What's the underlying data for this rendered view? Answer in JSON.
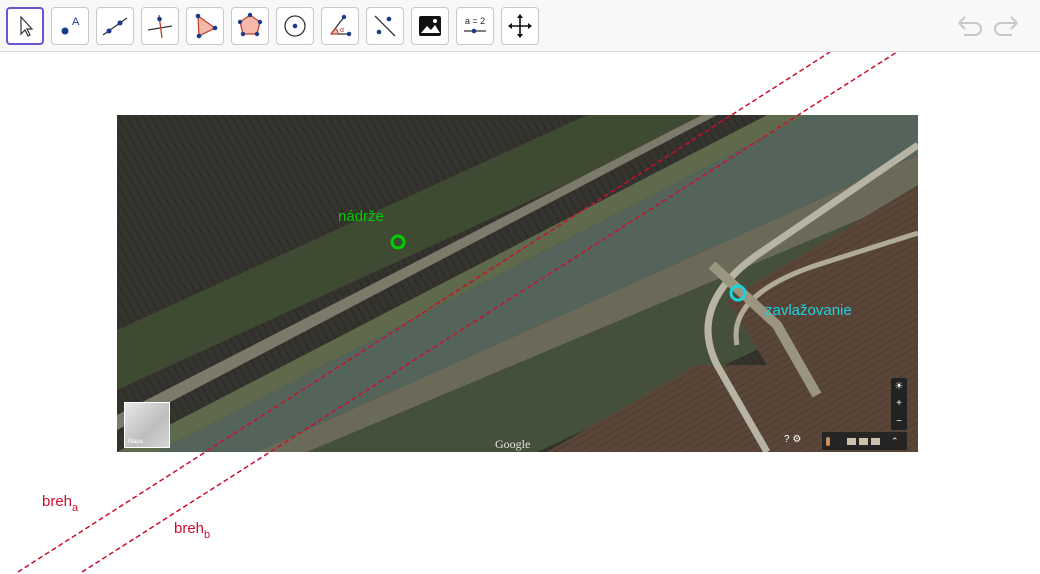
{
  "toolbar": {
    "tools": [
      {
        "icon": "move-arrow-icon",
        "selected": true
      },
      {
        "icon": "point-icon",
        "label": "A"
      },
      {
        "icon": "line-icon"
      },
      {
        "icon": "perpendicular-line-icon"
      },
      {
        "icon": "polygon-icon"
      },
      {
        "icon": "circle-with-center-icon"
      },
      {
        "icon": "angle-icon"
      },
      {
        "icon": "reflect-about-line-icon"
      },
      {
        "icon": "image-icon"
      },
      {
        "icon": "slider-icon",
        "label": "a = 2"
      },
      {
        "icon": "move-graphics-view-icon"
      }
    ],
    "undo_icon": "undo-icon",
    "redo_icon": "redo-icon"
  },
  "map": {
    "logo": "Google",
    "thumb_label": "Mapa"
  },
  "points": {
    "nadrze": {
      "label": "nádrže",
      "color": "#00cc00"
    },
    "zavlazovanie": {
      "label": "zavlažovanie",
      "color": "#19d3df"
    }
  },
  "lines": {
    "breh_a": {
      "base": "breh",
      "sub": "a",
      "color": "#c8102e"
    },
    "breh_b": {
      "base": "breh",
      "sub": "b",
      "color": "#c8102e"
    }
  }
}
